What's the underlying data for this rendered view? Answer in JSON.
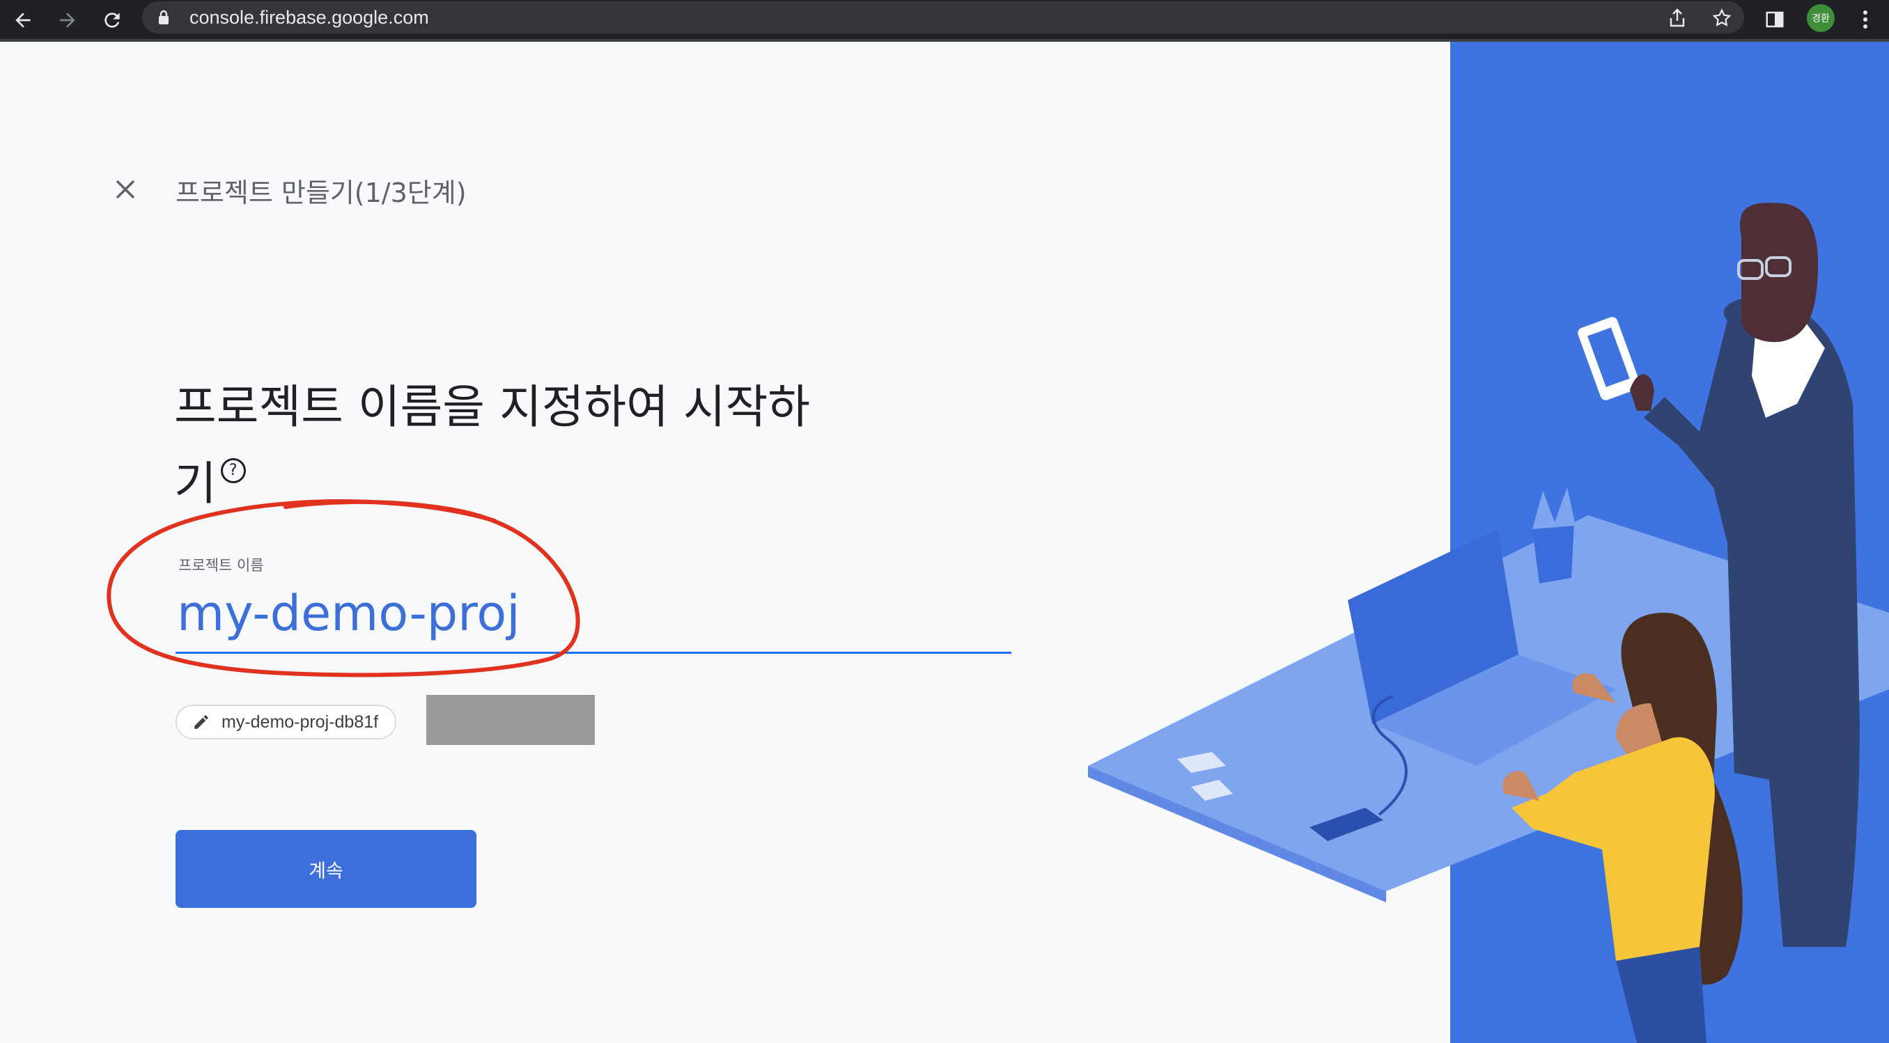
{
  "browser": {
    "url": "console.firebase.google.com",
    "profile_label": "경환",
    "icons": [
      "back-arrow-icon",
      "forward-arrow-icon",
      "reload-icon",
      "lock-icon",
      "share-icon",
      "star-icon",
      "side-panel-icon",
      "more-vert-icon"
    ]
  },
  "wizard": {
    "step_title": "프로젝트 만들기(1/3단계)",
    "heading": "프로젝트 이름을 지정하여 시작하기",
    "help_glyph": "?",
    "project_name_label": "프로젝트 이름",
    "project_name_value": "my-demo-proj",
    "project_id_chip": "my-demo-proj-db81f",
    "continue_label": "계속"
  },
  "colors": {
    "page_bg": "#f8f9fa",
    "illustration_bg": "#3f73e0",
    "primary_button": "#3d6fdc",
    "input_text": "#3c6fd8",
    "annotation_red": "#e0321f"
  }
}
